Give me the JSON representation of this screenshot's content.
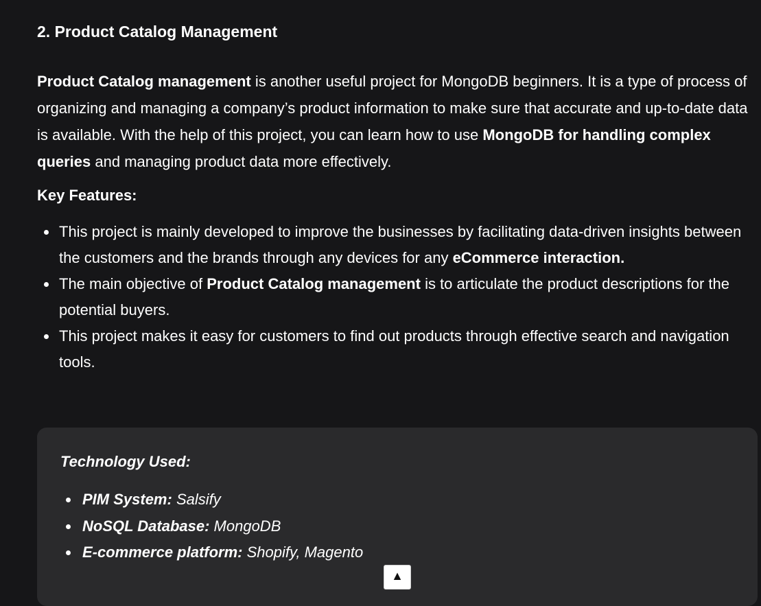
{
  "section": {
    "title": "2. Product Catalog Management"
  },
  "intro": {
    "bold_lead": "Product Catalog management",
    "text_1": " is another useful project for MongoDB beginners. It is a type of process of organizing and managing a company’s product information to make sure that accurate and up-to-date data is available. With the help of this project, you can learn how to use ",
    "bold_mid": "MongoDB for handling complex queries",
    "text_2": " and managing product data more effectively."
  },
  "key_features": {
    "heading": "Key Features:",
    "items": [
      {
        "text_1": "This project is mainly developed to improve the businesses by facilitating data-driven insights between the customers and the brands through any devices for any ",
        "bold": "eCommerce interaction."
      },
      {
        "text_1": "The main objective of ",
        "bold": "Product Catalog management",
        "text_2": " is to articulate the product descriptions for the potential buyers."
      },
      {
        "text_1": "This project makes it easy for customers to find out products through effective search and navigation tools."
      }
    ]
  },
  "technology": {
    "title": "Technology Used:",
    "items": [
      {
        "label": "PIM System:",
        "value": " Salsify"
      },
      {
        "label": "NoSQL Database:",
        "value": " MongoDB"
      },
      {
        "label": "E-commerce platform:",
        "value": " Shopify, Magento"
      }
    ]
  },
  "scroll_top": {
    "icon": "arrow-up-icon",
    "glyph": "▲"
  },
  "colors": {
    "background": "#161618",
    "text": "#ffffff",
    "tech_box_background": "#2a2a2c",
    "scroll_button_background": "#ffffff"
  }
}
